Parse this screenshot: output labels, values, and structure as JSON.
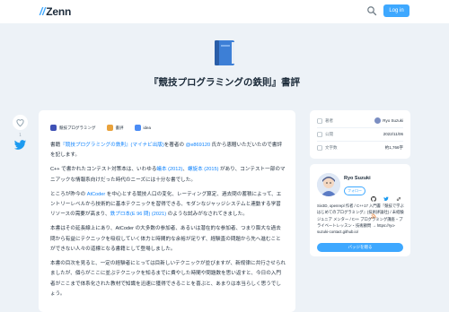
{
  "header": {
    "logo_mark": "//",
    "logo_text": "Zenn",
    "login_label": "Log in"
  },
  "article": {
    "emoji_name": "blue-book",
    "title": "『競技プログラミングの鉄則』書評",
    "topics": [
      {
        "label": "競技プログラミング",
        "icon": "competitive-programming-icon",
        "color": "#3f51b5"
      },
      {
        "label": "書評",
        "icon": "book-review-icon",
        "color": "#e9a23b"
      },
      {
        "label": "idea",
        "icon": "idea-icon",
        "color": "#4b8cf5"
      }
    ],
    "paragraphs": [
      [
        {
          "t": "書籍"
        },
        {
          "t": "『競技プログラミングの鉄則』(マイナビ出版)",
          "link": true
        },
        {
          "t": "を著者の "
        },
        {
          "t": "@e869120",
          "link": true
        },
        {
          "t": " 氏から恵贈いただいたので書評を記します。"
        }
      ],
      [
        {
          "t": "C++ で書かれたコンテスト対策本は、いわゆる"
        },
        {
          "t": "蟻本 (2012)",
          "link": true
        },
        {
          "t": "、"
        },
        {
          "t": "螺旋本 (2015)",
          "link": true
        },
        {
          "t": " があり、コンテスト一部のマニアックな情報系向けだった時代のニーズには十分な書でした。"
        }
      ],
      [
        {
          "t": "ところが昨今の "
        },
        {
          "t": "AtCoder",
          "link": true
        },
        {
          "t": " を中心とする競技人口の変化、レーティング算定、過去問の蓄積によって、エントリーレベルから技術的に基本テクニックを習得できる、モダンなジャッジシステムと連動する学習リソースの需要が高まり、"
        },
        {
          "t": "鉄プロ本(E 96 問) (2021)",
          "link": true
        },
        {
          "t": " のような試みがなされてきました。"
        }
      ],
      [
        {
          "t": "本書はその延長線上にあり、AtCoder の大多数の参加者、あるいは潜在的な参加者、つまり膨大な過去問から有益にテクニックを吸収していく体力と時間的な余裕が足りず、経験直の問題から先へ進むことができない人々の道標となる書籍として登場しました。"
        }
      ],
      [
        {
          "t": "本書の目次を見ると、一定の経験者にとっては目新しいテクニックが並びますが、新规律に共行させられましたが、個らがここに並ぶテクニックを知るまでに費やした時間や問題数を思い返すと、今日の入門者がここまで体系化された教材で知識を迅速に獲得できることを喜ぶと、あまりは本当らしく思うでしょう。"
        }
      ]
    ],
    "likes": "1"
  },
  "info": {
    "rows": [
      {
        "icon": "type-icon",
        "label": "著者",
        "value": "Ryo Suzuki",
        "avatar": true
      },
      {
        "icon": "calendar-icon",
        "label": "公開",
        "value": "2022/11/06"
      },
      {
        "icon": "book-icon",
        "label": "文字数",
        "value": "約1,766字"
      }
    ]
  },
  "author": {
    "name": "Ryo Suzuki",
    "follow_label": "フォロー",
    "bio": "Siv3D, openrepl 作者 / C++17 入門書『競技で学ぶ はじめてのプログラミング』(技術評論社) / 未経験ジュニア メンター / C++ プログラミング講座・プライベートレッスン・技術顧問 → https://ryo-suzuki-contact.github.io/",
    "badge_label": "バッジを贈る"
  },
  "colors": {
    "accent": "#3ea8ff",
    "link": "#0f83fd",
    "background": "#edf2f7",
    "twitter": "#1d9bf0"
  }
}
